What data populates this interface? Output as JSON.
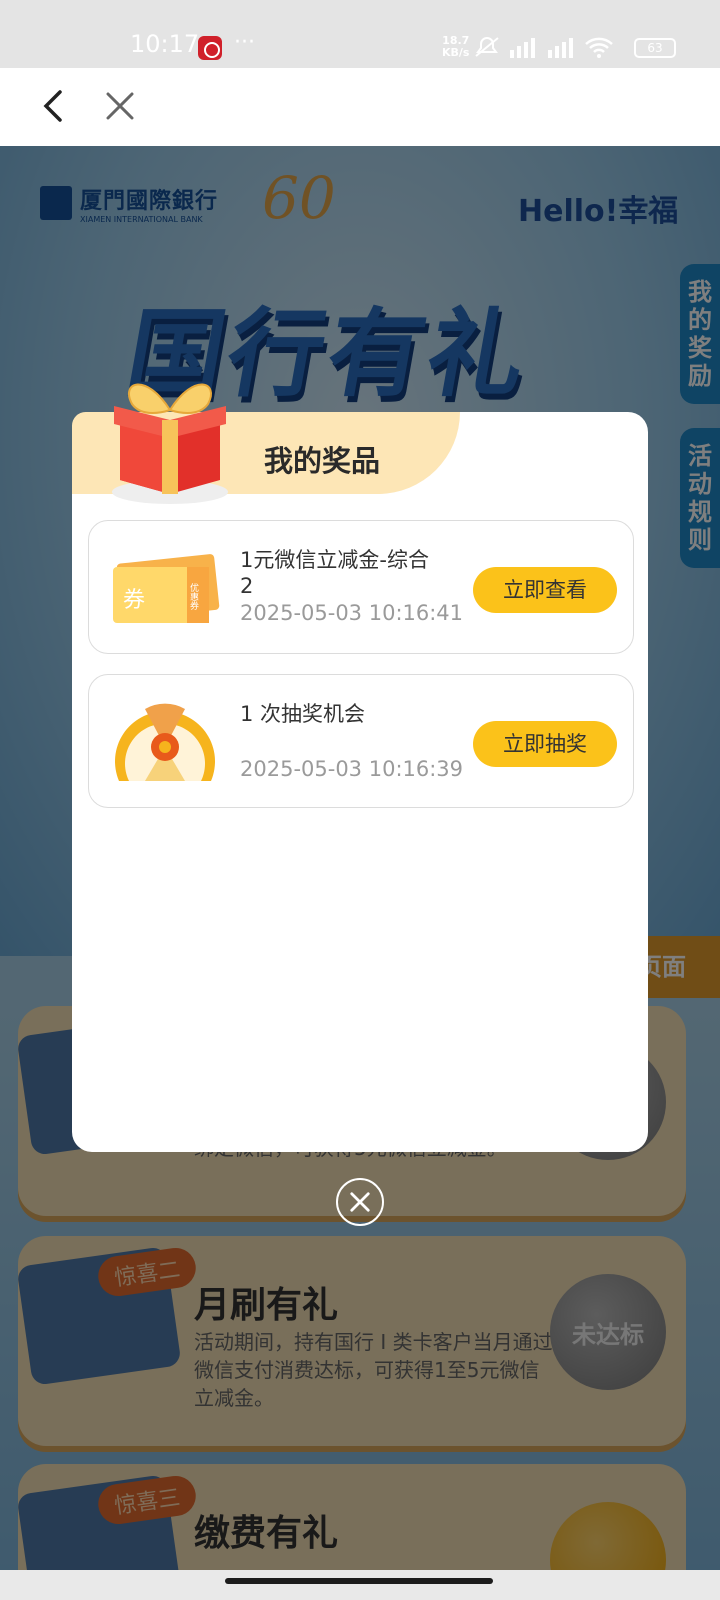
{
  "status_bar": {
    "time": "10:17",
    "more": "···",
    "net_speed_value": "18.7",
    "net_speed_unit": "KB/s",
    "battery": "63"
  },
  "nav": {
    "back_icon": "chevron-left-icon",
    "close_icon": "close-icon"
  },
  "background": {
    "bank_name": "厦門國際銀行",
    "bank_name_en": "XIAMEN INTERNATIONAL BANK",
    "anniversary": "60",
    "hello_brand": "Hello!幸福",
    "hero_title": "国行有礼",
    "side_tabs": [
      {
        "label": "我的奖励"
      },
      {
        "label": "活动规则"
      }
    ],
    "side_strip": "页面",
    "cards": [
      {
        "title": "",
        "desc": "绑定微信，可获得5元微信立减金。",
        "badge": "",
        "status": ""
      },
      {
        "title": "月刷有礼",
        "desc": "活动期间，持有国行 I 类卡客户当月通过微信支付消费达标，可获得1至5元微信立减金。",
        "badge": "惊喜二",
        "status": "未达标"
      },
      {
        "title": "缴费有礼",
        "desc": "",
        "badge": "惊喜三",
        "status": ""
      }
    ]
  },
  "modal": {
    "title": "我的奖品",
    "prizes": [
      {
        "name": "1元微信立减金-综合2",
        "time": "2025-05-03 10:16:41",
        "button": "立即查看",
        "icon": "coupon-icon",
        "coupon_text": "券",
        "coupon_side": "优惠券"
      },
      {
        "name": "1 次抽奖机会",
        "time": "2025-05-03 10:16:39",
        "button": "立即抽奖",
        "icon": "lottery-wheel-icon"
      }
    ],
    "close_icon": "close-circle-icon"
  },
  "colors": {
    "accent_yellow": "#fbc21a",
    "header_bg": "#fde6b6",
    "overlay": "rgba(0,0,0,0.5)"
  }
}
